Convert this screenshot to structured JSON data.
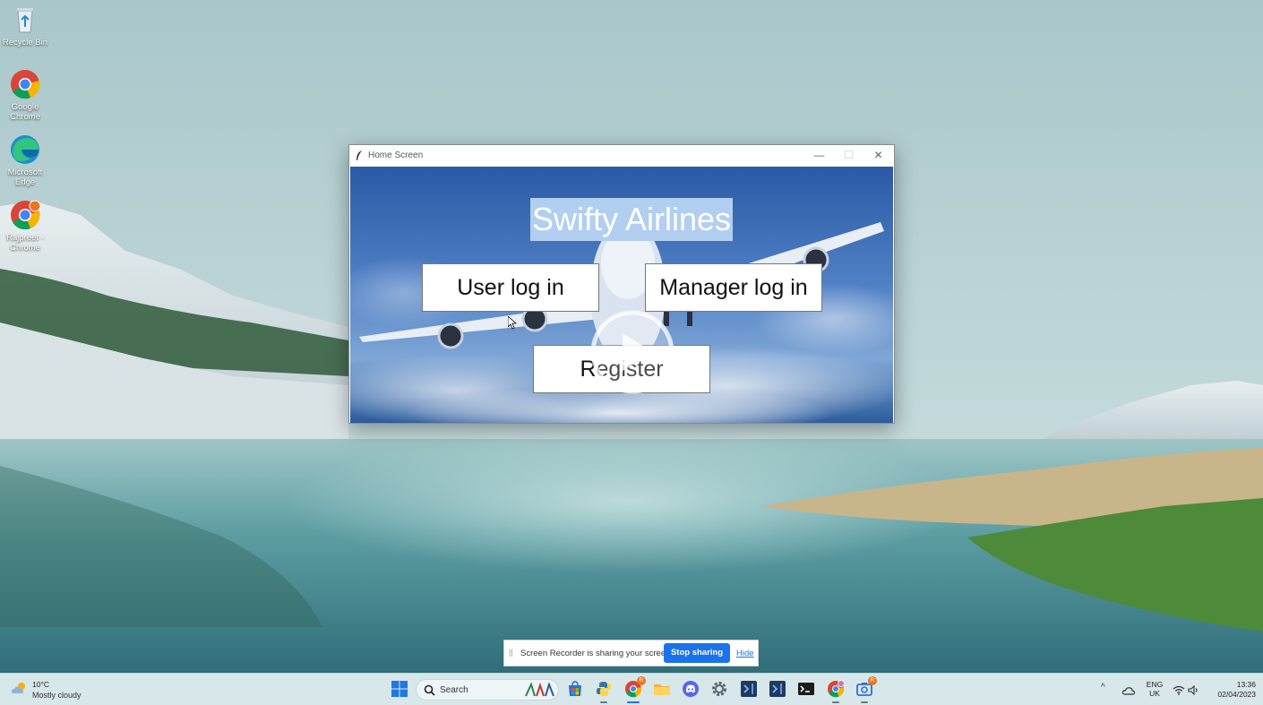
{
  "desktop": {
    "icons": [
      {
        "label": "Recycle Bin"
      },
      {
        "label": "Google Chrome"
      },
      {
        "label": "Microsoft Edge"
      },
      {
        "label": "Rajpreet - Chrome"
      }
    ]
  },
  "window": {
    "title": "Home Screen",
    "min_glyph": "—",
    "max_glyph": "☐",
    "close_glyph": "✕"
  },
  "app": {
    "heading": "Swifty Airlines",
    "user_login_label": "User log in",
    "manager_login_label": "Manager log in",
    "register_label": "Register"
  },
  "share_bar": {
    "message": "Screen Recorder is sharing your screen.",
    "stop_label": "Stop sharing",
    "hide_label": "Hide"
  },
  "taskbar": {
    "weather_temp": "10°C",
    "weather_condition": "Mostly cloudy",
    "search_placeholder": "Search",
    "pinned_apps": [
      {
        "name": "start"
      },
      {
        "name": "store"
      },
      {
        "name": "python"
      },
      {
        "name": "chrome",
        "badge": "R"
      },
      {
        "name": "file-explorer"
      },
      {
        "name": "discord"
      },
      {
        "name": "settings"
      },
      {
        "name": "vscode-1"
      },
      {
        "name": "vscode-2"
      },
      {
        "name": "terminal"
      },
      {
        "name": "chrome-profile"
      },
      {
        "name": "screen-recorder",
        "badge": "R"
      }
    ],
    "tray_chevron": "^",
    "language_line1": "ENG",
    "language_line2": "UK",
    "time": "13:36",
    "date": "02/04/2023"
  },
  "colors": {
    "heading_bg": "#b3cff0",
    "share_button": "#1a73e8",
    "taskbar_bg": "#d7e7ea"
  }
}
